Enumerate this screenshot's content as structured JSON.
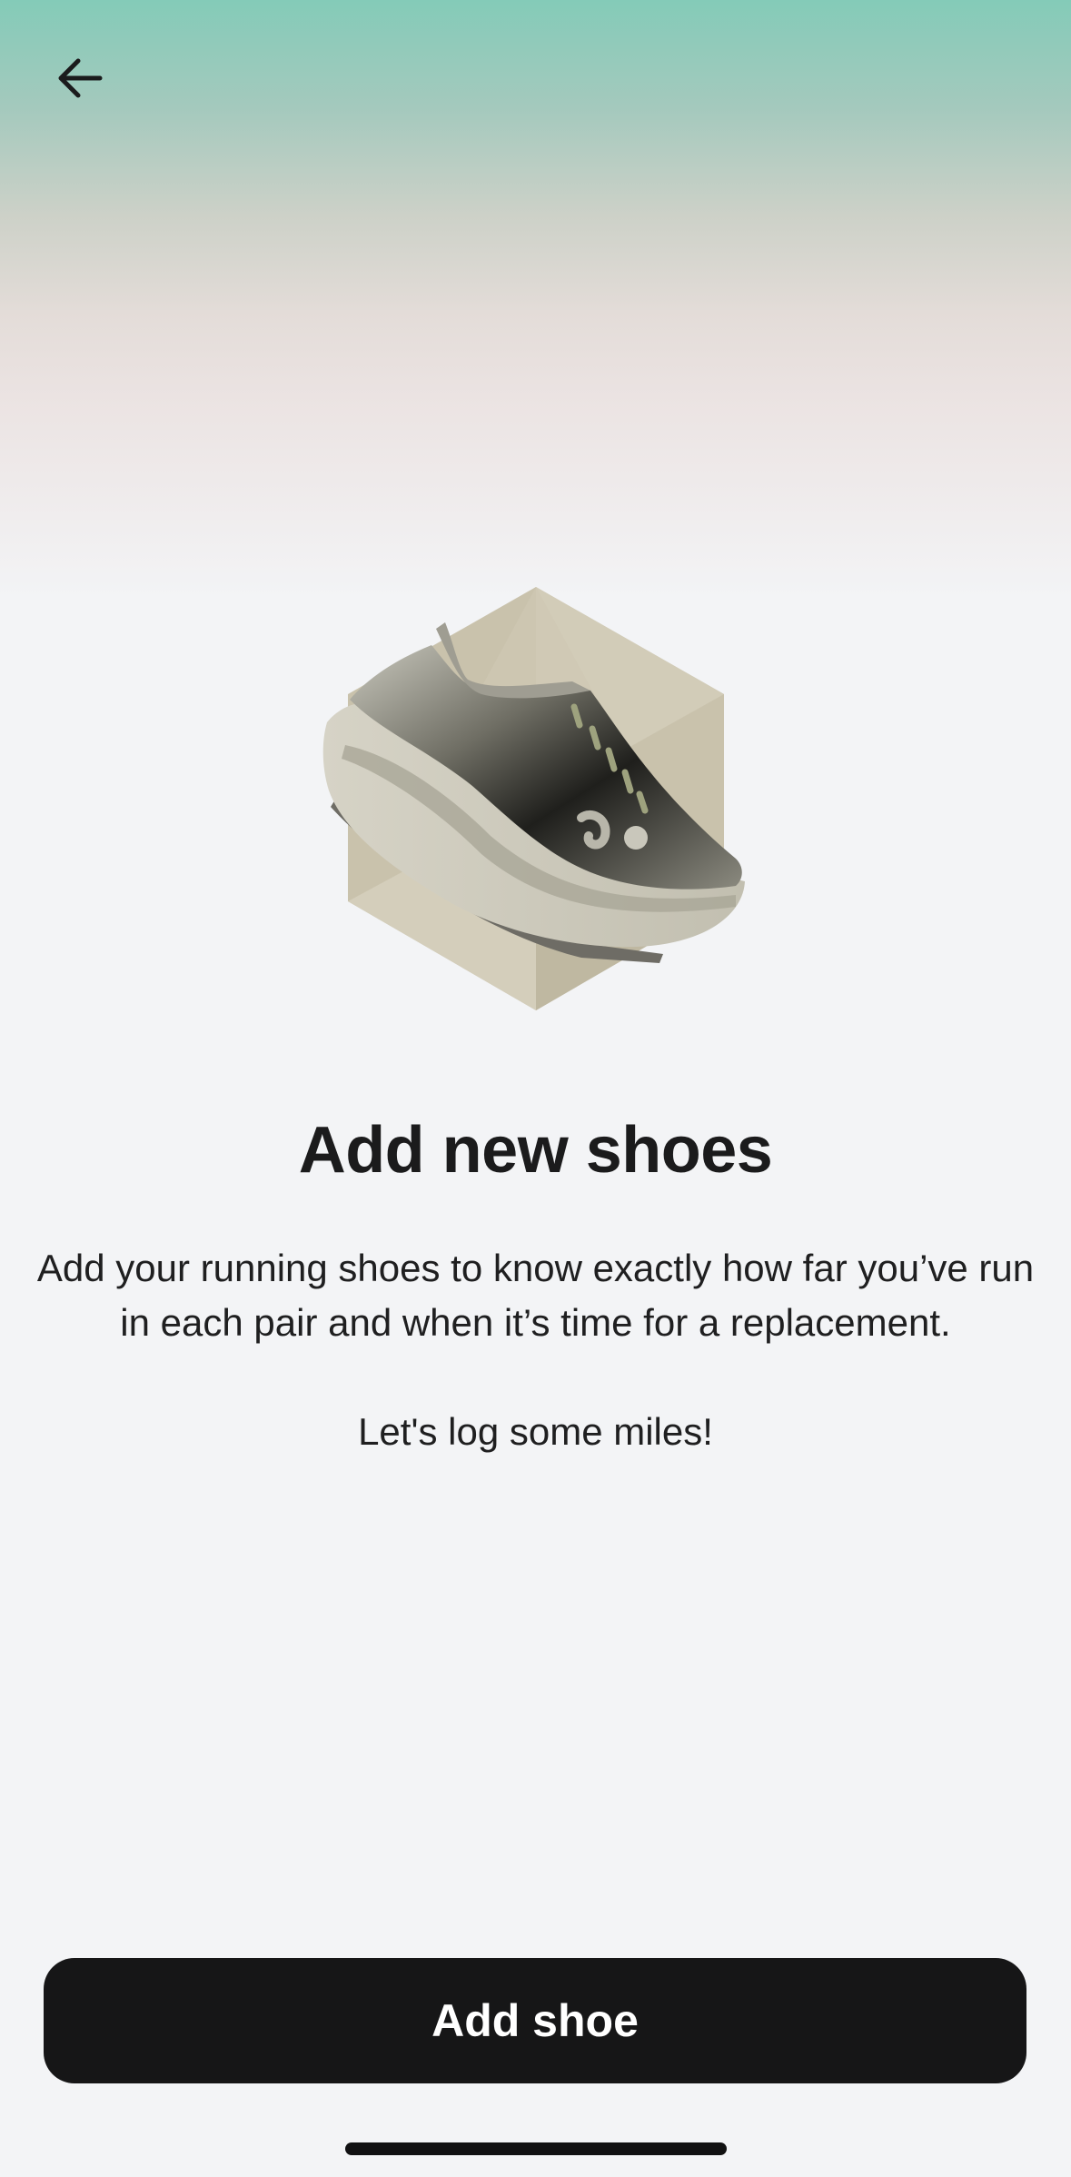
{
  "nav": {
    "back_icon": "arrow-left-icon"
  },
  "hero": {
    "illustration": "running-shoe-hexagon-illustration"
  },
  "content": {
    "title": "Add new shoes",
    "description": "Add your running shoes to know exactly how far you’ve run in each pair and when it’s time for a replacement.",
    "tagline": "Let's log some miles!"
  },
  "actions": {
    "add_shoe_label": "Add shoe"
  },
  "colors": {
    "gradient_top": "#84cbb8",
    "background": "#f3f4f6",
    "button": "#161617",
    "button_text": "#ffffff"
  }
}
